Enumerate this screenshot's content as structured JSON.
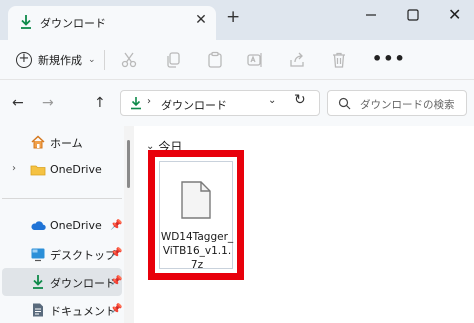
{
  "window": {
    "tab_title": "ダウンロード",
    "tab_close_glyph": "✕",
    "new_tab_glyph": "+",
    "close_glyph": "✕"
  },
  "toolbar": {
    "new_label": "新規作成",
    "new_caret": "⌄",
    "more_glyph": "•••"
  },
  "nav": {
    "back_glyph": "←",
    "forward_glyph": "→",
    "up_glyph": "↑"
  },
  "address": {
    "chevron": "›",
    "path": "ダウンロード",
    "dropdown_glyph": "⌄",
    "refresh_glyph": "↻"
  },
  "search": {
    "placeholder": "ダウンロードの検索"
  },
  "sidebar": {
    "items": [
      {
        "label": "ホーム",
        "icon": "home-icon",
        "chevron": "",
        "pinned": false
      },
      {
        "label": "OneDrive",
        "icon": "folder-icon",
        "chevron": "›",
        "pinned": false
      },
      {
        "label": "OneDrive",
        "icon": "cloud-icon",
        "chevron": "",
        "pinned": true
      },
      {
        "label": "デスクトップ",
        "icon": "desktop-icon",
        "chevron": "",
        "pinned": true
      },
      {
        "label": "ダウンロード",
        "icon": "download-icon",
        "chevron": "",
        "pinned": true,
        "selected": true
      },
      {
        "label": "ドキュメント",
        "icon": "document-icon",
        "chevron": "",
        "pinned": true
      }
    ],
    "pin_glyph": "📌"
  },
  "content": {
    "group_chevron": "⌄",
    "group_label": "今日",
    "file_name": "WD14Tagger_ViTB16_v1.1.7z"
  },
  "colors": {
    "accent": "#0f7b3f",
    "highlight": "#e8000b"
  }
}
